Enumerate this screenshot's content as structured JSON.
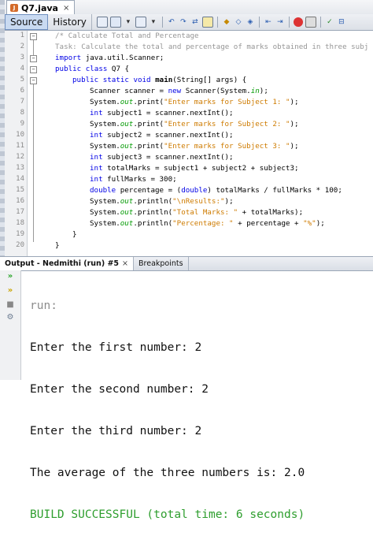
{
  "file_tab": {
    "name": "Q7.java",
    "close": "×"
  },
  "toolbar": {
    "source_label": "Source",
    "history_label": "History"
  },
  "line_numbers": [
    "1",
    "2",
    "3",
    "4",
    "5",
    "6",
    "7",
    "8",
    "9",
    "10",
    "11",
    "12",
    "13",
    "14",
    "15",
    "16",
    "17",
    "18",
    "19",
    "20"
  ],
  "code": {
    "l1": "/* Calculate Total and Percentage",
    "l2": "Task: Calculate the total and percentage of marks obtained in three subj",
    "l3_kw": "import",
    "l3_rest": " java.util.Scanner;",
    "l4_kw": "public class",
    "l4_rest": " Q7 {",
    "l5_kw": "public static void",
    "l5_main": "main",
    "l5_rest": "(String[] args) {",
    "l6_a": "Scanner scanner = ",
    "l6_kw": "new",
    "l6_b": " Scanner(System.",
    "l6_in": "in",
    "l6_c": ");",
    "l7_a": "System.",
    "l7_out": "out",
    "l7_b": ".print(",
    "l7_str": "\"Enter marks for Subject 1: \"",
    "l7_c": ");",
    "l8_kw": "int",
    "l8_rest": " subject1 = scanner.nextInt();",
    "l9_a": "System.",
    "l9_out": "out",
    "l9_b": ".print(",
    "l9_str": "\"Enter marks for Subject 2: \"",
    "l9_c": ");",
    "l10_kw": "int",
    "l10_rest": " subject2 = scanner.nextInt();",
    "l11_a": "System.",
    "l11_out": "out",
    "l11_b": ".print(",
    "l11_str": "\"Enter marks for Subject 3: \"",
    "l11_c": ");",
    "l12_kw": "int",
    "l12_rest": " subject3 = scanner.nextInt();",
    "l13_kw": "int",
    "l13_rest": " totalMarks = subject1 + subject2 + subject3;",
    "l14_kw": "int",
    "l14_rest": " fullMarks = 300;",
    "l15_kw": "double",
    "l15_a": " percentage = (",
    "l15_kw2": "double",
    "l15_b": ") totalMarks / fullMarks * 100;",
    "l16_a": "System.",
    "l16_out": "out",
    "l16_b": ".println(",
    "l16_str": "\"\\nResults:\"",
    "l16_c": ");",
    "l17_a": "System.",
    "l17_out": "out",
    "l17_b": ".println(",
    "l17_str": "\"Total Marks: \"",
    "l17_c": " + totalMarks);",
    "l18_a": "System.",
    "l18_out": "out",
    "l18_b": ".println(",
    "l18_str": "\"Percentage: \"",
    "l18_c": " + percentage + ",
    "l18_str2": "\"%\"",
    "l18_d": ");",
    "l19": "}",
    "l20": "}"
  },
  "output_panel": {
    "tab_output": "Output - Nedmithi (run) #5",
    "tab_close": "×",
    "tab_breakpoints": "Breakpoints",
    "lines": {
      "run": "run:",
      "l1": "Enter the first number: 2",
      "l2": "Enter the second number: 2",
      "l3": "Enter the third number: 2",
      "l4": "The average of the three numbers is: 2.0",
      "l5": "BUILD SUCCESSFUL (total time: 6 seconds)"
    }
  },
  "colors": {
    "keyword": "#0000e6",
    "comment": "#969696",
    "string": "#ce7b00",
    "field": "#009900",
    "build_success": "#2e9e2e"
  }
}
